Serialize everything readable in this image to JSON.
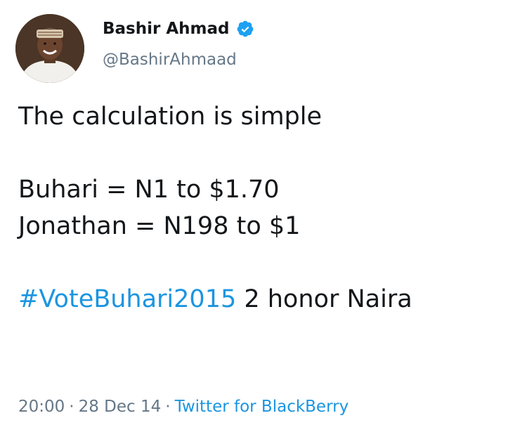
{
  "colors": {
    "text": "#14171a",
    "secondary_text": "#657786",
    "link": "#1b95e0",
    "verified_badge": "#1da1f2"
  },
  "author": {
    "display_name": "Bashir Ahmad",
    "handle": "@BashirAhmaad",
    "verified": true,
    "avatar_icon": "profile-photo"
  },
  "tweet": {
    "line1": "The calculation is simple",
    "line2": "Buhari = N1 to $1.70",
    "line3": "Jonathan = N198 to $1",
    "hashtag": "#VoteBuhari2015",
    "line4_rest": " 2 honor Naira"
  },
  "footer": {
    "time": "20:00",
    "separator": "·",
    "date": "28 Dec 14",
    "source": "Twitter for BlackBerry"
  }
}
